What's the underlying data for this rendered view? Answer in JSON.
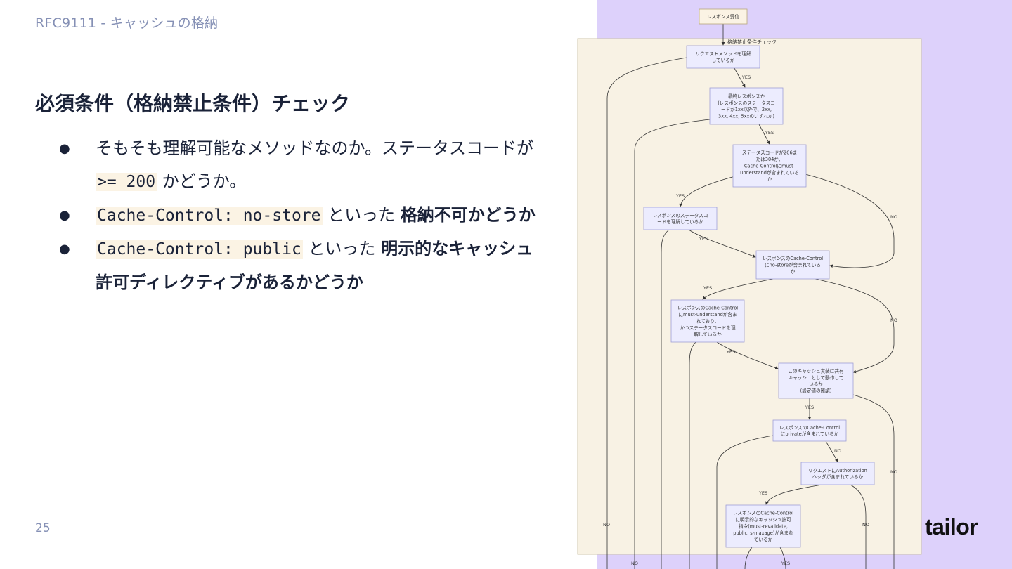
{
  "header": {
    "breadcrumb": "RFC9111 - キャッシュの格納"
  },
  "main": {
    "heading": "必須条件（格納禁止条件）チェック",
    "bullets": [
      {
        "bullet": "●",
        "text1": "そもそも理解可能なメソッドなのか。ステータスコードが",
        "code": ">= 200",
        "text2": "かどうか。"
      },
      {
        "bullet": "●",
        "code": "Cache-Control: no-store",
        "text1": "といった",
        "bold": "格納不可かどうか"
      },
      {
        "bullet": "●",
        "code": "Cache-Control: public",
        "text1": "といった",
        "bold": "明示的なキャッシュ許可ディレクティブがあるかどうか"
      }
    ]
  },
  "footer": {
    "page_number": "25",
    "logo": "tailor"
  },
  "flowchart": {
    "start": [
      "レスポンス受信"
    ],
    "group_label": "格納禁止条件チェック",
    "nodes": {
      "n1": [
        "リクエストメソッドを理解",
        "しているか"
      ],
      "n2": [
        "最終レスポンスか",
        "(レスポンスのステータスコ",
        "ードが1xx以外で、2xx,",
        "3xx, 4xx, 5xxのいずれか)"
      ],
      "n3": [
        "ステータスコードが206ま",
        "たは304か、",
        "Cache-Controlにmust-",
        "understandが含まれている",
        "か"
      ],
      "n4": [
        "レスポンスのステータスコ",
        "ードを理解しているか"
      ],
      "n5": [
        "レスポンスのCache-Control",
        "にno-storeが含まれている",
        "か"
      ],
      "n6": [
        "レスポンスのCache-Control",
        "にmust-understandが含ま",
        "れており、",
        "かつステータスコードを理",
        "解しているか"
      ],
      "n7": [
        "このキャッシュ実装は共有",
        "キャッシュとして動作して",
        "いるか",
        "(設定値の確認)"
      ],
      "n8": [
        "レスポンスのCache-Control",
        "にprivateが含まれているか"
      ],
      "n9": [
        "リクエストにAuthorization",
        "ヘッダが含まれているか"
      ],
      "n10": [
        "レスポンスのCache-Control",
        "に明示的なキャッシュ許可",
        "指令(must-revalidate,",
        "public, s-maxage)が含まれ",
        "ているか"
      ]
    },
    "edge_labels": {
      "yes": "YES",
      "no": "NO"
    }
  },
  "colors": {
    "background_right": "#ddd1fb",
    "flow_group": "#f8f2e4",
    "node_fill": "#ececfe",
    "node_stroke": "#9f9fd6",
    "text_dark": "#1a2238",
    "muted": "#8590b5",
    "code_bg": "#fbf3e4"
  }
}
